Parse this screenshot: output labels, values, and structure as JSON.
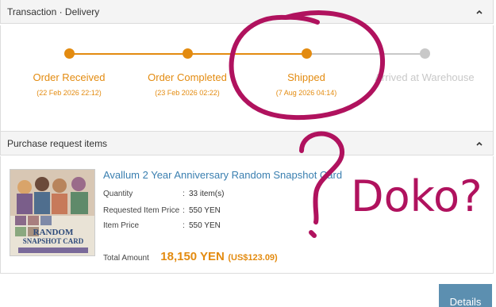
{
  "transaction": {
    "header": "Transaction · Delivery",
    "steps": [
      {
        "label": "Order Received",
        "date": "(22 Feb 2026 22:12)",
        "state": "done"
      },
      {
        "label": "Order Completed",
        "date": "(23 Feb 2026 02:22)",
        "state": "done"
      },
      {
        "label": "Shipped",
        "date": "(7 Aug 2026 04:14)",
        "state": "done"
      },
      {
        "label": "Arrived at Warehouse",
        "date": "",
        "state": "pending"
      }
    ]
  },
  "purchase": {
    "header": "Purchase request items",
    "item": {
      "title": "Avallum 2 Year Anniversary Random Snapshot Card",
      "quantity_label": "Quantity",
      "quantity_value": "33 item(s)",
      "requested_price_label": "Requested Item Price",
      "requested_price_value": "550 YEN",
      "item_price_label": "Item Price",
      "item_price_value": "550 YEN",
      "total_label": "Total Amount",
      "total_value": "18,150 YEN",
      "total_usd": "(US$123.09)",
      "thumb_text_line1": "RANDOM",
      "thumb_text_line2": "SNAPSHOT CARD"
    }
  },
  "buttons": {
    "details_label": "Details"
  },
  "annotation": {
    "handwriting": "Doko?",
    "question_mark": "?"
  },
  "colors": {
    "accent": "#e38b10",
    "link": "#3a7fb0",
    "pending": "#c8c8c8",
    "marker": "#b0125e",
    "button": "#5c8fb0"
  },
  "icons": {
    "collapse": "chevron-up-icon"
  }
}
